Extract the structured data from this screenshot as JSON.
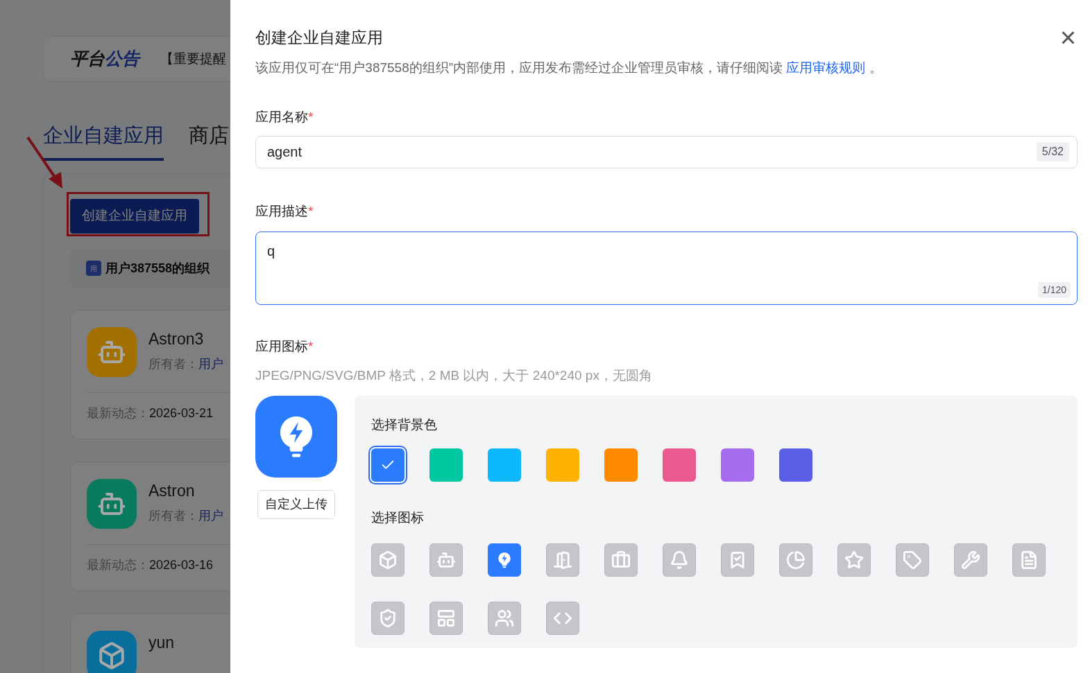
{
  "background_page": {
    "announcement": {
      "title_parts": [
        {
          "text": "平台",
          "accent": false
        },
        {
          "text": "公告",
          "accent": true
        }
      ],
      "text": "【重要提醒"
    },
    "tabs": [
      {
        "label": "企业自建应用",
        "selected": true
      },
      {
        "label": "商店",
        "selected": false
      }
    ],
    "create_button": "创建企业自建应用",
    "org": {
      "badge": "用",
      "name": "用户387558的组织"
    },
    "apps": [
      {
        "name": "Astron3",
        "kind": "robot",
        "color": "#a17000",
        "owner_label": "所有者：",
        "owner": "用户",
        "updated_label": "最新动态：",
        "updated": "2026-03-21"
      },
      {
        "name": "Astron",
        "kind": "robot",
        "color": "#0a7a5e",
        "owner_label": "所有者：",
        "owner": "用户",
        "updated_label": "最新动态：",
        "updated": "2026-03-16"
      },
      {
        "name": "yun",
        "kind": "cube",
        "color": "#0a6e9c"
      }
    ]
  },
  "drawer": {
    "title": "创建企业自建应用",
    "close": "×",
    "notice": "该应用仅可在“用户387558的组织”内部使用，应用发布需经过企业管理员审核，请仔细阅读",
    "notice_link": "应用审核规则",
    "notice_end": "。",
    "name_field": {
      "label": "应用名称",
      "required_mark": "*",
      "value": "agent",
      "count": "5/32"
    },
    "desc_field": {
      "label": "应用描述",
      "required_mark": "*",
      "value": "q",
      "count": "1/120"
    },
    "icon_field": {
      "label": "应用图标",
      "required_mark": "*",
      "hint": "JPEG/PNG/SVG/BMP 格式，2 MB 以内，大于 240*240 px，无圆角",
      "upload": "自定义上传",
      "color_label": "选择背景色",
      "colors": [
        {
          "color": "#2b7bff",
          "selected": true
        },
        {
          "color": "#00c8a0",
          "selected": false
        },
        {
          "color": "#0db8ff",
          "selected": false
        },
        {
          "color": "#ffb300",
          "selected": false
        },
        {
          "color": "#ff8a00",
          "selected": false
        },
        {
          "color": "#ea5a8e",
          "selected": false
        },
        {
          "color": "#a66cf0",
          "selected": false
        },
        {
          "color": "#5a5ee6",
          "selected": false
        }
      ],
      "icon_label": "选择图标",
      "icons": [
        {
          "kind": "cube",
          "selected": false
        },
        {
          "kind": "robot",
          "selected": false
        },
        {
          "kind": "bulb",
          "selected": true
        },
        {
          "kind": "door",
          "selected": false
        },
        {
          "kind": "briefcase",
          "selected": false
        },
        {
          "kind": "bell",
          "selected": false
        },
        {
          "kind": "bookmark",
          "selected": false
        },
        {
          "kind": "pie",
          "selected": false
        },
        {
          "kind": "star",
          "selected": false
        },
        {
          "kind": "tag",
          "selected": false
        },
        {
          "kind": "wrench",
          "selected": false
        },
        {
          "kind": "file",
          "selected": false
        },
        {
          "kind": "shield",
          "selected": false
        },
        {
          "kind": "layout",
          "selected": false
        },
        {
          "kind": "users",
          "selected": false
        },
        {
          "kind": "code",
          "selected": false
        }
      ]
    }
  }
}
